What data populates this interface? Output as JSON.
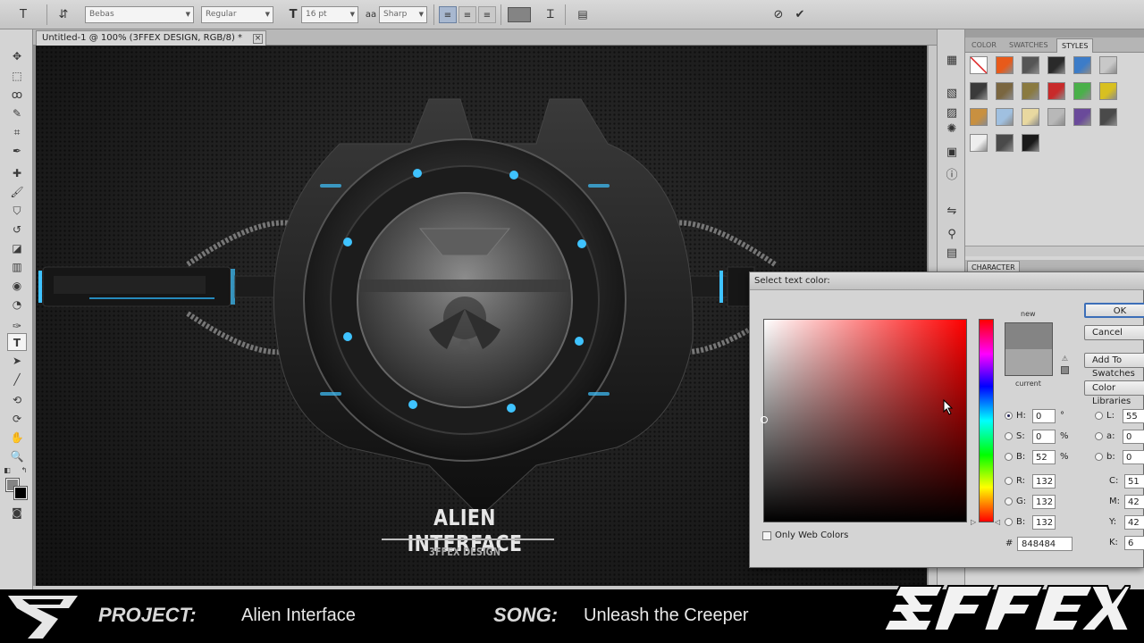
{
  "options_bar": {
    "tool_glyph": "T",
    "font_family": "Bebas",
    "font_style": "Regular",
    "font_size": "16 pt",
    "aa_label": "aa",
    "antialias": "Sharp",
    "text_color": "#848484"
  },
  "document": {
    "tab_title": "Untitled-1 @ 100% (3FFEX DESIGN, RGB/8) *",
    "close_glyph": "×"
  },
  "artwork": {
    "title": "ALIEN INTERFACE",
    "subtitle": "3FFEX DESIGN",
    "accent": "#3fc3ff"
  },
  "panels": {
    "tabs": [
      "COLOR",
      "SWATCHES",
      "STYLES"
    ],
    "active_tab": "STYLES",
    "character_tab": "CHARACTER",
    "styles": [
      [
        "#ffffff",
        "#e85a1a",
        "#555555",
        "#2a2a2a",
        "#3c7cc8",
        "#c8c8c8"
      ],
      [
        "#3a3a3a",
        "#7a6640",
        "#8a7a40",
        "#c82a2a",
        "#4ab04a",
        "#d8c020"
      ],
      [
        "#c89040",
        "#a0c0e0",
        "#e8d8a0",
        "#b8b8b8",
        "#6a4a9a",
        "#4a4a4a"
      ],
      [
        "#eeeeee",
        "#4a4a4a",
        "#1a1a1a"
      ]
    ]
  },
  "color_picker": {
    "title": "Select text color:",
    "new_label": "new",
    "current_label": "current",
    "new_color": "#848484",
    "current_color": "#a6a6a6",
    "buttons": {
      "ok": "OK",
      "cancel": "Cancel",
      "add_swatches": "Add To Swatches",
      "color_libraries": "Color Libraries"
    },
    "hsb": [
      {
        "label": "H:",
        "value": "0",
        "unit": "°"
      },
      {
        "label": "S:",
        "value": "0",
        "unit": "%"
      },
      {
        "label": "B:",
        "value": "52",
        "unit": "%"
      }
    ],
    "rgb": [
      {
        "label": "R:",
        "value": "132"
      },
      {
        "label": "G:",
        "value": "132"
      },
      {
        "label": "B:",
        "value": "132"
      }
    ],
    "lab": [
      {
        "label": "L:",
        "value": "55"
      },
      {
        "label": "a:",
        "value": "0"
      },
      {
        "label": "b:",
        "value": "0"
      }
    ],
    "cmyk": [
      {
        "label": "C:",
        "value": "51"
      },
      {
        "label": "M:",
        "value": "42"
      },
      {
        "label": "Y:",
        "value": "42"
      },
      {
        "label": "K:",
        "value": "6"
      }
    ],
    "hex_label": "#",
    "hex": "848484",
    "web_colors_label": "Only Web Colors"
  },
  "overlay": {
    "project_label": "PROJECT:",
    "project_value": "Alien Interface",
    "song_label": "SONG:",
    "song_value": "Unleash the Creeper"
  }
}
